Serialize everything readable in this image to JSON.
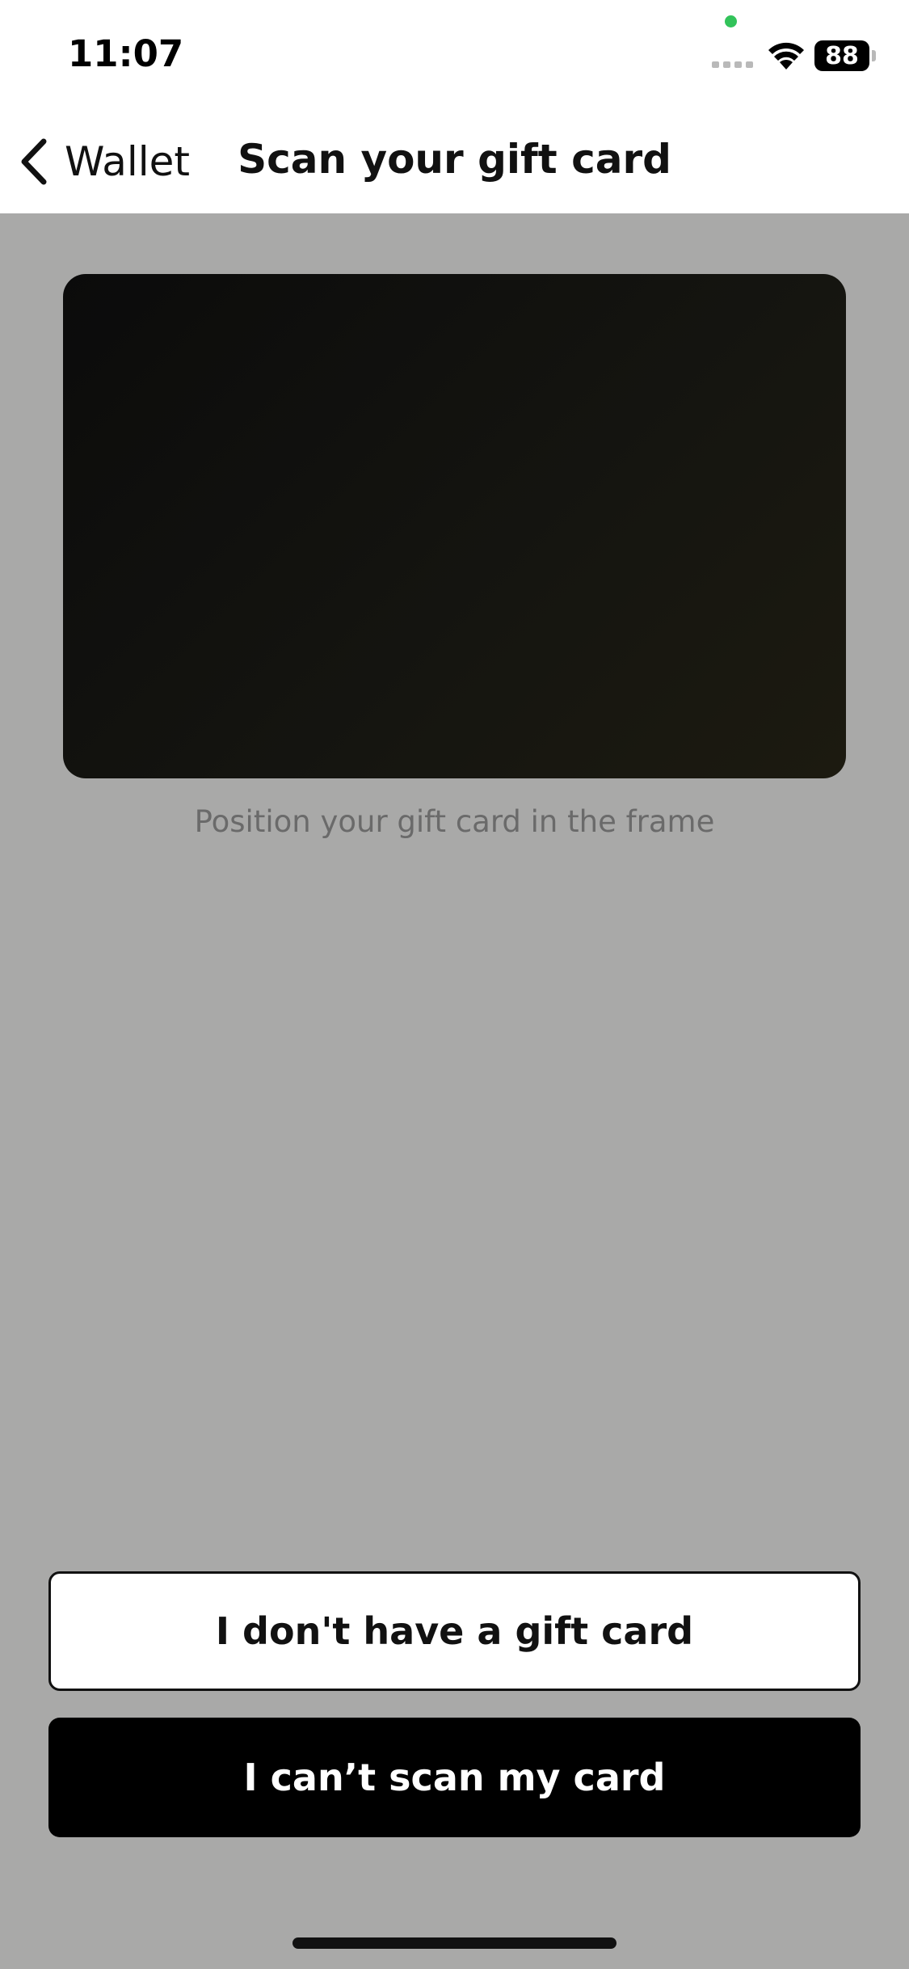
{
  "status_bar": {
    "time": "11:07",
    "battery": "88"
  },
  "nav": {
    "back_label": "Wallet",
    "title": "Scan your gift card"
  },
  "scan": {
    "hint": "Position your gift card in the frame"
  },
  "actions": {
    "no_card_label": "I don't have a gift card",
    "cant_scan_label": "I can’t scan my card"
  },
  "colors": {
    "background": "#a9a9a8",
    "primary_button": "#000000",
    "camera_indicator": "#32c35a"
  },
  "icons": {
    "back": "chevron-left-icon",
    "wifi": "wifi-icon",
    "battery": "battery-icon",
    "signal": "cellular-signal-icon"
  }
}
